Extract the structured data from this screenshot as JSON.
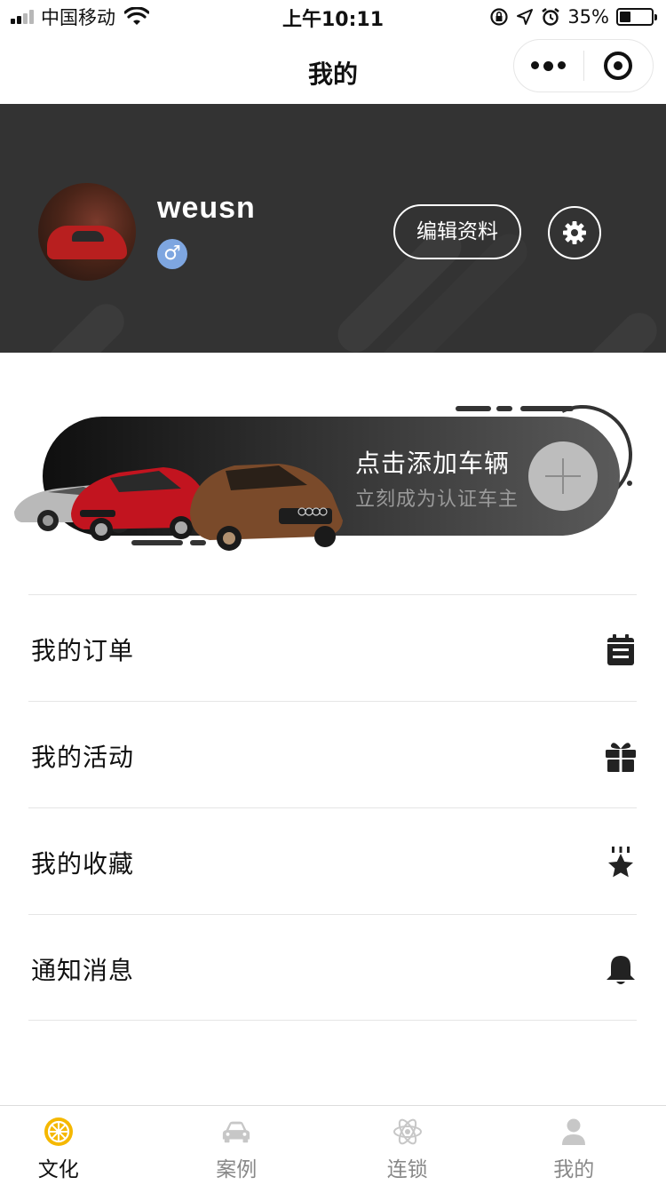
{
  "status_bar": {
    "carrier": "中国移动",
    "time": "上午10:11",
    "battery_percent": "35%",
    "battery_level": 0.35
  },
  "nav": {
    "title": "我的"
  },
  "profile": {
    "username": "weusn",
    "gender_symbol": "♂",
    "edit_label": "编辑资料"
  },
  "banner": {
    "title": "点击添加车辆",
    "subtitle": "立刻成为认证车主"
  },
  "menu": {
    "items": [
      {
        "label": "我的订单",
        "icon": "calendar-icon"
      },
      {
        "label": "我的活动",
        "icon": "gift-icon"
      },
      {
        "label": "我的收藏",
        "icon": "star-icon"
      },
      {
        "label": "通知消息",
        "icon": "bell-icon"
      }
    ]
  },
  "tabbar": {
    "tabs": [
      {
        "label": "文化",
        "icon": "wheel-icon",
        "active": true
      },
      {
        "label": "案例",
        "icon": "car-icon",
        "active": false
      },
      {
        "label": "连锁",
        "icon": "atom-icon",
        "active": false
      },
      {
        "label": "我的",
        "icon": "user-icon",
        "active": false
      }
    ]
  },
  "colors": {
    "header_bg": "#333333",
    "accent": "#f5b800",
    "gender_badge": "#7ea6e0",
    "inactive_tab": "#888888"
  }
}
